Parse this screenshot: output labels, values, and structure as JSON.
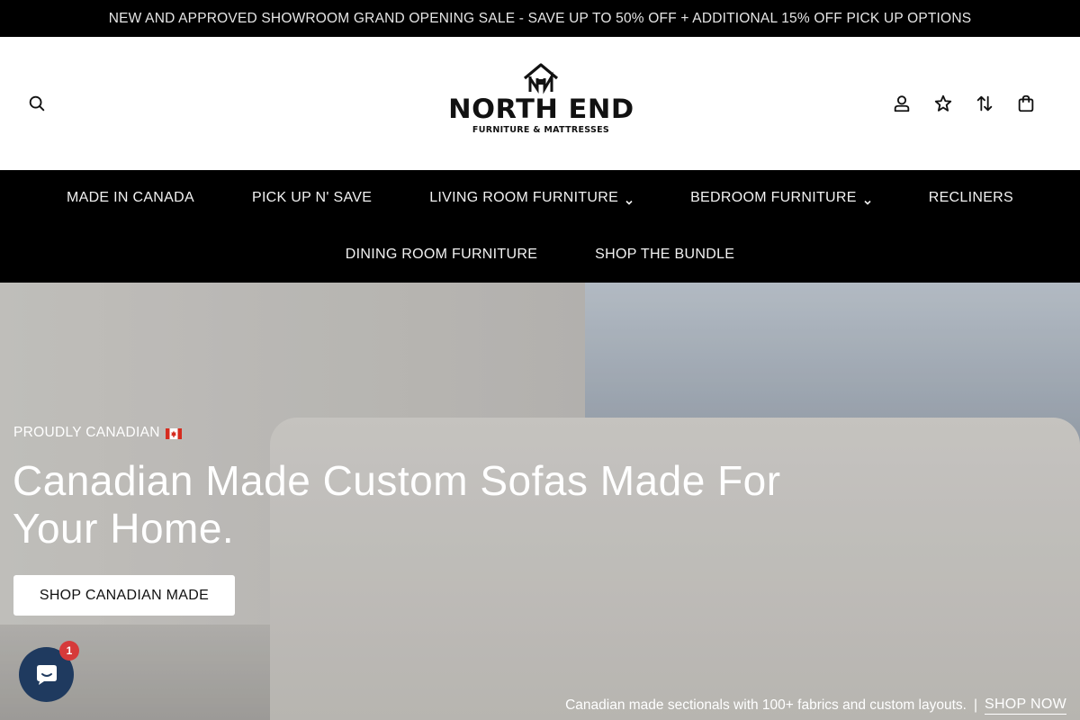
{
  "announcement": "NEW AND APPROVED SHOWROOM GRAND OPENING SALE - SAVE UP TO 50% OFF + ADDITIONAL 15% OFF PICK UP OPTIONS",
  "logo": {
    "wordmark": "NORTH END",
    "subtitle": "FURNITURE & MATTRESSES"
  },
  "header_icons": [
    "search-icon",
    "account-icon",
    "wishlist-star-icon",
    "compare-icon",
    "cart-bag-icon"
  ],
  "nav": {
    "row1": [
      {
        "label": "MADE IN CANADA",
        "dropdown": false
      },
      {
        "label": "PICK UP N' SAVE",
        "dropdown": false
      },
      {
        "label": "LIVING ROOM FURNITURE",
        "dropdown": true
      },
      {
        "label": "BEDROOM FURNITURE",
        "dropdown": true
      },
      {
        "label": "RECLINERS",
        "dropdown": false
      }
    ],
    "row2": [
      {
        "label": "DINING ROOM FURNITURE",
        "dropdown": false
      },
      {
        "label": "SHOP THE BUNDLE",
        "dropdown": false
      }
    ]
  },
  "hero": {
    "eyebrow": "PROUDLY CANADIAN",
    "headline": "Canadian Made Custom Sofas Made For Your Home.",
    "cta": "SHOP CANADIAN MADE",
    "caption": "Canadian made sectionals with 100+ fabrics and custom layouts.",
    "caption_separator": "|",
    "caption_link": "SHOP NOW"
  },
  "chat": {
    "badge_count": "1"
  },
  "colors": {
    "bar": "#000000",
    "chat": "#1f3a5f",
    "badge": "#d63a3a"
  }
}
